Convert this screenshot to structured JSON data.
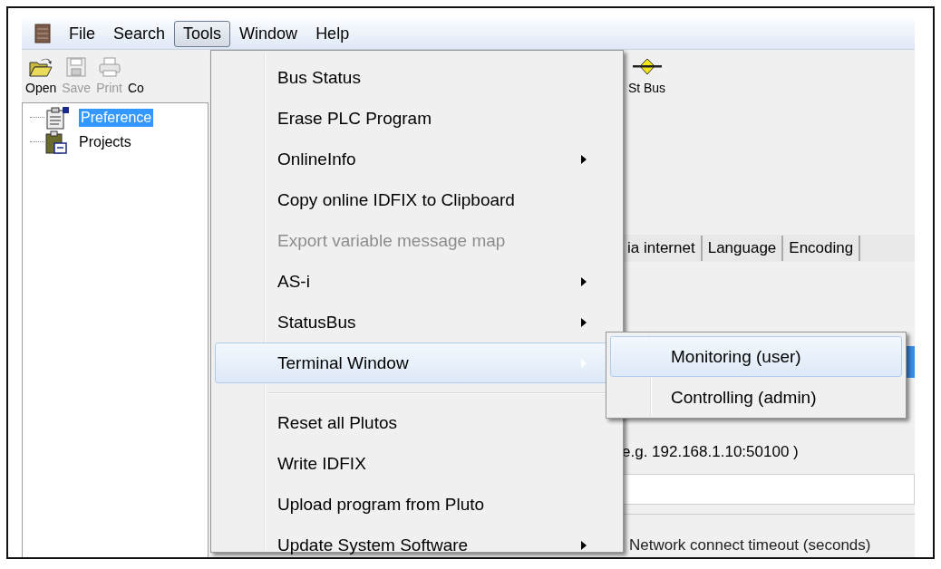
{
  "menubar": [
    {
      "label": "File",
      "selected": false
    },
    {
      "label": "Search",
      "selected": false
    },
    {
      "label": "Tools",
      "selected": true
    },
    {
      "label": "Window",
      "selected": false
    },
    {
      "label": "Help",
      "selected": false
    }
  ],
  "toolbar": [
    {
      "kind": "open",
      "label": "Open",
      "disabled": false
    },
    {
      "kind": "save",
      "label": "Save",
      "disabled": true
    },
    {
      "kind": "print",
      "label": "Print",
      "disabled": true
    },
    {
      "kind": "copy",
      "label": "Co",
      "disabled": false
    },
    {
      "kind": "bus",
      "label": "St Bus",
      "disabled": false
    }
  ],
  "tree": [
    {
      "kind": "preferences",
      "label": "Preference",
      "selected": true
    },
    {
      "kind": "projects",
      "label": "Projects",
      "selected": false
    }
  ],
  "settings": {
    "tabs": [
      {
        "label": "ia internet",
        "selected": false
      },
      {
        "label": "Language",
        "selected": false
      },
      {
        "label": "Encoding",
        "selected": false
      }
    ],
    "address_hint": "e.g. 192.168.1.10:50100 )",
    "timeout_label": "Network connect timeout (seconds)"
  },
  "tools_menu": [
    {
      "kind": "item",
      "label": "Bus Status",
      "submenu": false,
      "disabled": false,
      "selected": false
    },
    {
      "kind": "item",
      "label": "Erase PLC Program",
      "submenu": false,
      "disabled": false,
      "selected": false
    },
    {
      "kind": "item",
      "label": "OnlineInfo",
      "submenu": true,
      "disabled": false,
      "selected": false
    },
    {
      "kind": "item",
      "label": "Copy online IDFIX to Clipboard",
      "submenu": false,
      "disabled": false,
      "selected": false
    },
    {
      "kind": "item",
      "label": "Export variable message map",
      "submenu": false,
      "disabled": true,
      "selected": false
    },
    {
      "kind": "item",
      "label": "AS-i",
      "submenu": true,
      "disabled": false,
      "selected": false
    },
    {
      "kind": "item",
      "label": "StatusBus",
      "submenu": true,
      "disabled": false,
      "selected": false
    },
    {
      "kind": "item",
      "label": "Terminal Window",
      "submenu": true,
      "disabled": false,
      "selected": true
    },
    {
      "kind": "separator"
    },
    {
      "kind": "item",
      "label": "Reset all Plutos",
      "submenu": false,
      "disabled": false,
      "selected": false
    },
    {
      "kind": "item",
      "label": "Write IDFIX",
      "submenu": false,
      "disabled": false,
      "selected": false
    },
    {
      "kind": "item",
      "label": "Upload program from Pluto",
      "submenu": false,
      "disabled": false,
      "selected": false
    },
    {
      "kind": "item",
      "label": "Update System Software",
      "submenu": true,
      "disabled": false,
      "selected": false
    }
  ],
  "terminal_submenu": [
    {
      "label": "Monitoring (user)",
      "selected": true
    },
    {
      "label": "Controlling (admin)",
      "selected": false
    }
  ]
}
